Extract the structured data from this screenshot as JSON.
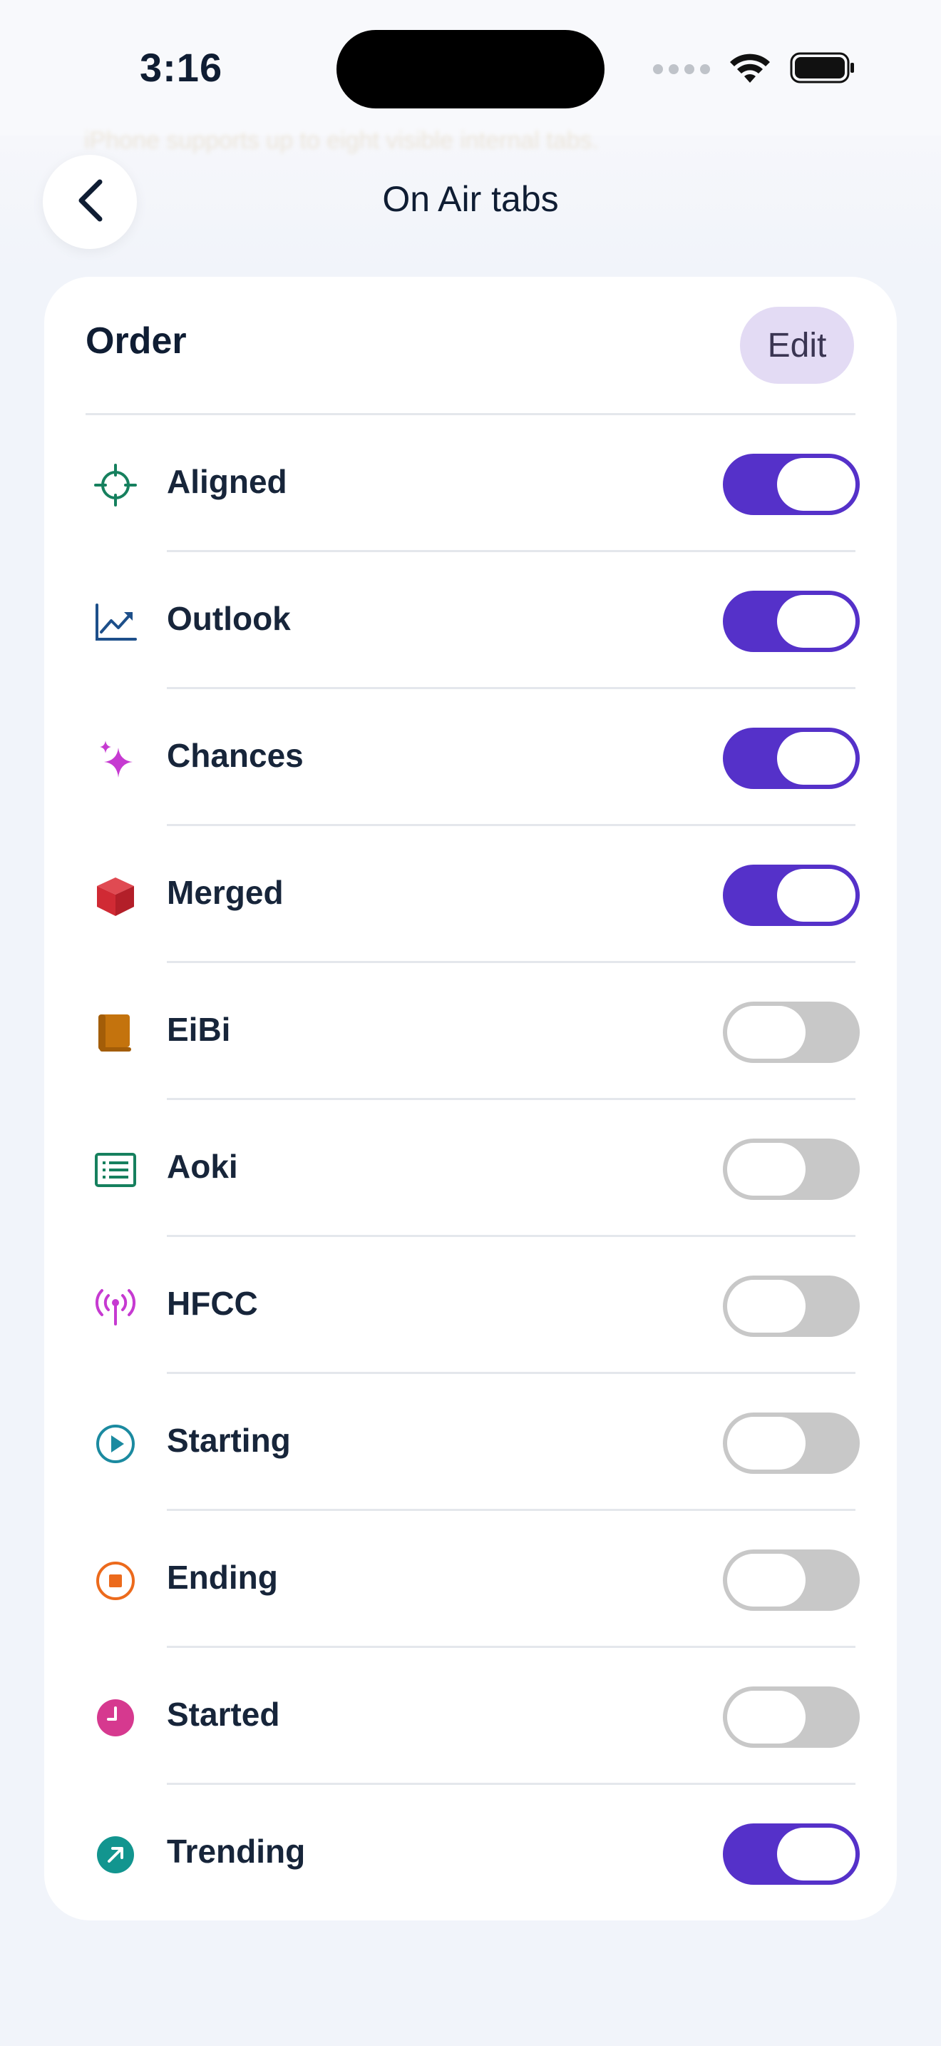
{
  "status_bar": {
    "time": "3:16"
  },
  "background_text": "iPhone supports up to eight visible internal tabs.",
  "nav": {
    "title": "On Air tabs",
    "back_icon": "chevron-left-icon"
  },
  "card": {
    "title": "Order",
    "edit_label": "Edit"
  },
  "colors": {
    "accent": "#5531c9",
    "toggle_off": "#c8c8c8",
    "edit_bg": "#e3dbf4"
  },
  "tabs": [
    {
      "label": "Aligned",
      "icon": "crosshair-icon",
      "icon_color": "#16805e",
      "enabled": true
    },
    {
      "label": "Outlook",
      "icon": "chart-trend-up-icon",
      "icon_color": "#1d4f8a",
      "enabled": true
    },
    {
      "label": "Chances",
      "icon": "sparkles-icon",
      "icon_color": "#c63ad1",
      "enabled": true
    },
    {
      "label": "Merged",
      "icon": "box-icon",
      "icon_color": "#d02a34",
      "enabled": true
    },
    {
      "label": "EiBi",
      "icon": "book-icon",
      "icon_color": "#c4730d",
      "enabled": false
    },
    {
      "label": "Aoki",
      "icon": "list-document-icon",
      "icon_color": "#16805e",
      "enabled": false
    },
    {
      "label": "HFCC",
      "icon": "antenna-icon",
      "icon_color": "#c63ad1",
      "enabled": false
    },
    {
      "label": "Starting",
      "icon": "play-circle-icon",
      "icon_color": "#1b8aa0",
      "enabled": false
    },
    {
      "label": "Ending",
      "icon": "stop-circle-icon",
      "icon_color": "#ec6a1c",
      "enabled": false
    },
    {
      "label": "Started",
      "icon": "clock-icon",
      "icon_color": "#d6398f",
      "enabled": false
    },
    {
      "label": "Trending",
      "icon": "arrow-up-right-circle-icon",
      "icon_color": "#12958f",
      "enabled": true
    }
  ]
}
